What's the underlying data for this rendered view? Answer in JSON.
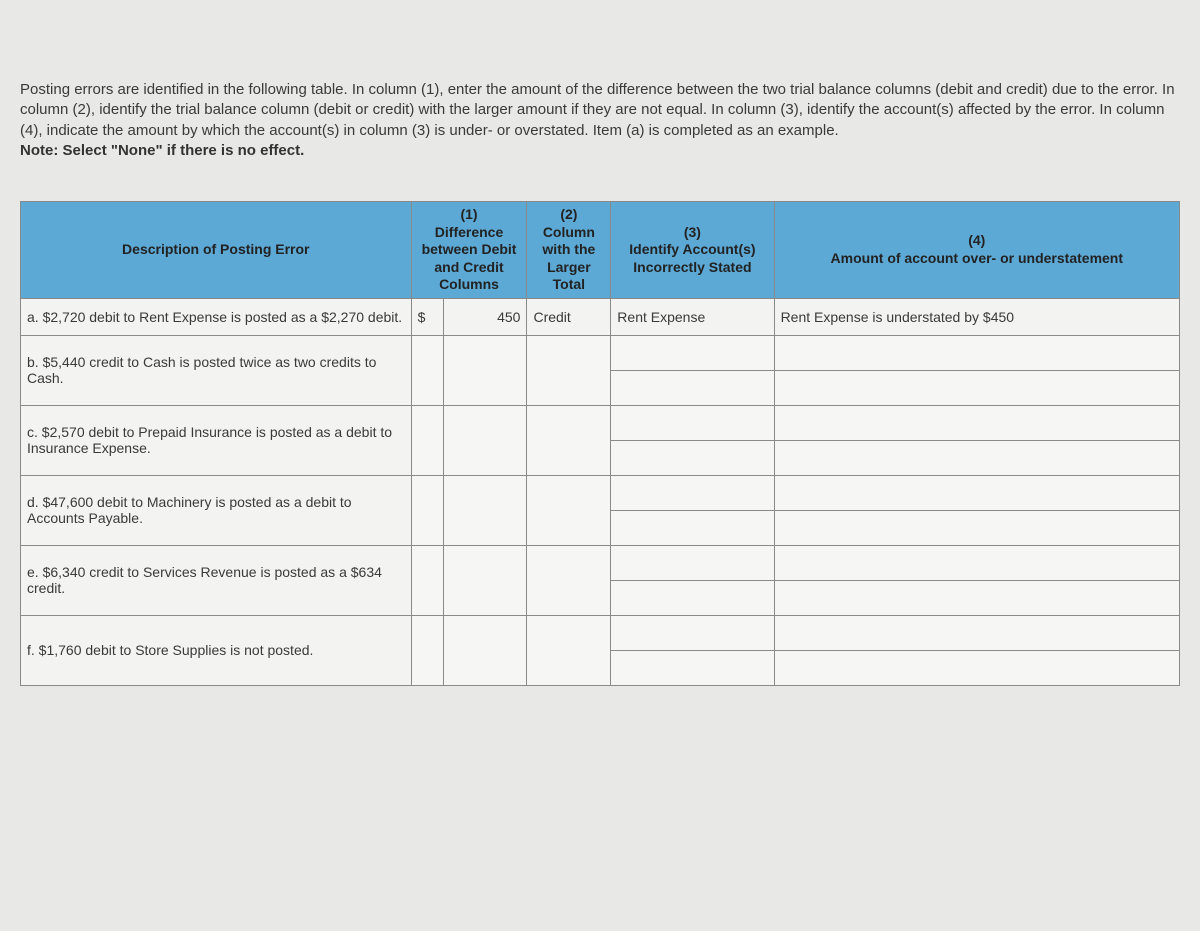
{
  "instructions": {
    "line1": "Posting errors are identified in the following table. In column (1), enter the amount of the difference between the two trial balance columns (debit and credit) due to the error. In column (2), identify the trial balance column (debit or credit) with the larger amount if they are not equal. In column (3), identify the account(s) affected by the error. In column (4), indicate the amount by which the account(s) in column (3) is under- or overstated. Item (a) is completed as an example.",
    "note": "Note: Select \"None\" if there is no effect."
  },
  "headers": {
    "desc": "Description of Posting Error",
    "col1": "(1)\nDifference between Debit and Credit Columns",
    "col2": "(2)\nColumn with the Larger Total",
    "col3": "(3)\nIdentify Account(s) Incorrectly Stated",
    "col4": "(4)\nAmount of account over- or understatement"
  },
  "rows": {
    "a": {
      "desc": "a. $2,720 debit to Rent Expense is posted as a $2,270 debit.",
      "sym": "$",
      "val": "450",
      "col2": "Credit",
      "col3": "Rent Expense",
      "col4": "Rent Expense is understated by $450"
    },
    "b": {
      "desc": "b. $5,440 credit to Cash is posted twice as two credits to Cash."
    },
    "c": {
      "desc": "c. $2,570 debit to Prepaid Insurance is posted as a debit to Insurance Expense."
    },
    "d": {
      "desc": "d. $47,600 debit to Machinery is posted as a debit to Accounts Payable."
    },
    "e": {
      "desc": "e. $6,340 credit to Services Revenue is posted as a $634 credit."
    },
    "f": {
      "desc": "f. $1,760 debit to Store Supplies is not posted."
    }
  }
}
